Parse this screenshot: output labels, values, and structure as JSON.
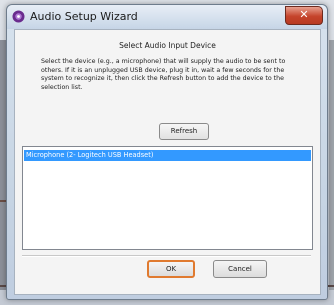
{
  "window": {
    "title": "Audio Setup Wizard",
    "close_icon": "close-x-icon",
    "app_icon": "audio-wizard-icon"
  },
  "dialog": {
    "heading": "Select Audio Input Device",
    "description": "Select the device (e.g., a microphone) that will supply the audio to be sent to others. If it is an unplugged USB device, plug it in, wait a few seconds for the system to recognize it, then click the Refresh button to add the device to the selection list.",
    "refresh_label": "Refresh",
    "devices": [
      {
        "label": "Microphone (2- Logitech USB Headset)",
        "selected": true
      }
    ],
    "ok_label": "OK",
    "cancel_label": "Cancel"
  },
  "colors": {
    "selection": "#3399ff",
    "focus_border": "#e07a2f",
    "close_button": "#c5442b"
  }
}
